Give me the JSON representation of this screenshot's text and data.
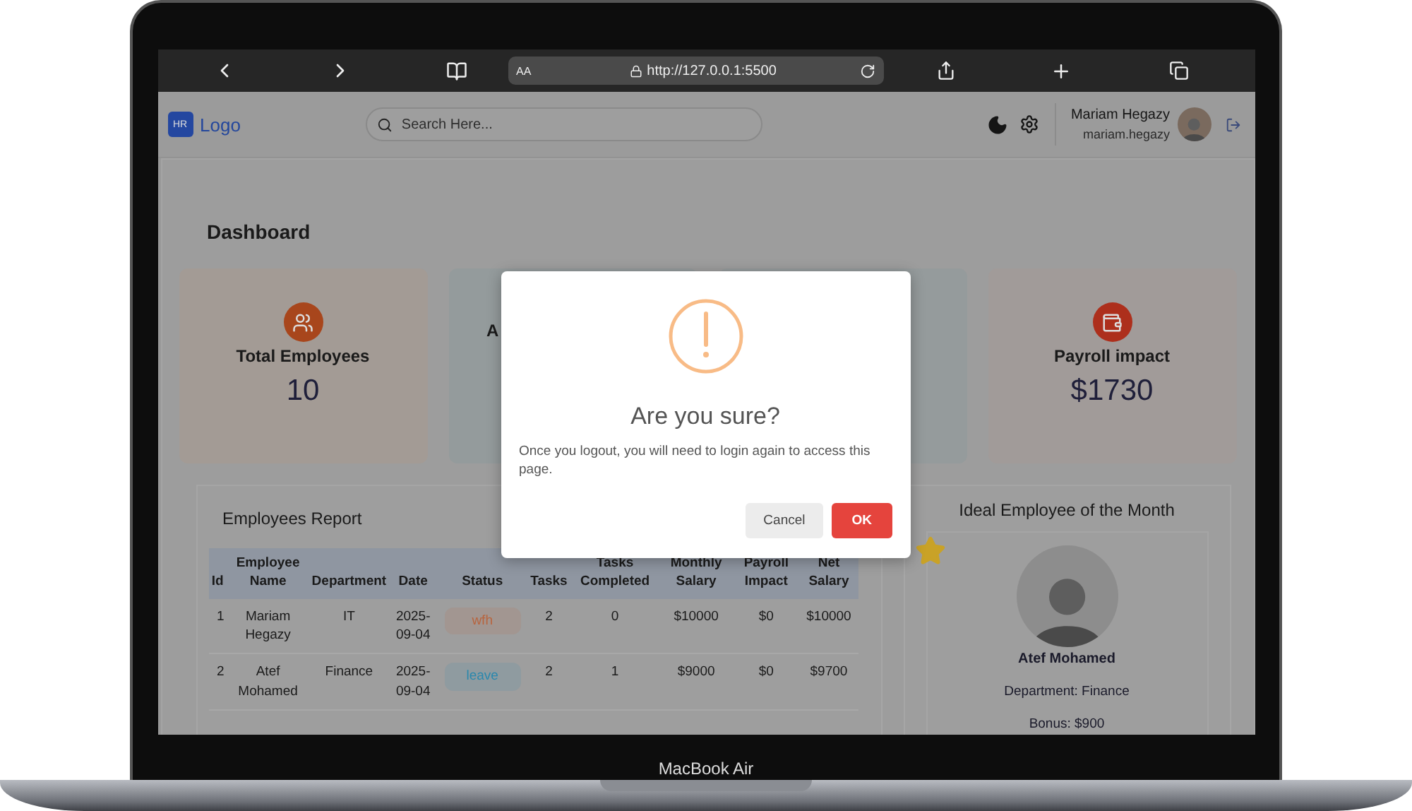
{
  "device": {
    "label": "MacBook Air"
  },
  "browser": {
    "reader_label": "AA",
    "url": "http://127.0.0.1:5500"
  },
  "header": {
    "logo_badge": "HR",
    "logo_text": "Logo",
    "search": {
      "placeholder": "Search Here..."
    },
    "user": {
      "name": "Mariam Hegazy",
      "username": "mariam.hegazy"
    }
  },
  "dashboard": {
    "title": "Dashboard",
    "cards": [
      {
        "kind": "users",
        "title": "Total Employees",
        "value": "10",
        "color": "#a39b95"
      },
      {
        "kind": "partial",
        "title": "A",
        "color": "#949b9c"
      },
      {
        "kind": "empty",
        "color": "#959b9c"
      },
      {
        "kind": "wallet",
        "title": "Payroll impact",
        "value": "$1730",
        "color": "#a19b99"
      }
    ]
  },
  "report": {
    "title": "Employees Report",
    "columns": [
      "Id",
      "Employee Name",
      "Department",
      "Date",
      "Status",
      "Tasks",
      "Tasks Completed",
      "Monthly Salary",
      "Payroll Impact",
      "Net Salary"
    ],
    "rows": [
      {
        "id": "1",
        "name": "Mariam Hegazy",
        "department": "IT",
        "date": "2025-09-04",
        "status": {
          "text": "wfh",
          "color": "#b8643e"
        },
        "tasks": "2",
        "completed": "0",
        "monthly": "$10000",
        "impact": "$0",
        "net": "$10000"
      },
      {
        "id": "2",
        "name": "Atef Mohamed",
        "department": "Finance",
        "date": "2025-09-04",
        "status": {
          "text": "leave",
          "color": "#2a88ad"
        },
        "tasks": "2",
        "completed": "1",
        "monthly": "$9000",
        "impact": "$0",
        "net": "$9700"
      }
    ]
  },
  "ideal": {
    "title": "Ideal Employee of the Month",
    "name": "Atef Mohamed",
    "department": "Department: Finance",
    "bonus": "Bonus: $900"
  },
  "modal": {
    "title": "Are you sure?",
    "message": "Once you logout, you will need to login again to access this page.",
    "buttons": [
      {
        "label": "Cancel",
        "kind": "cancel"
      },
      {
        "label": "OK",
        "kind": "confirm"
      }
    ]
  }
}
